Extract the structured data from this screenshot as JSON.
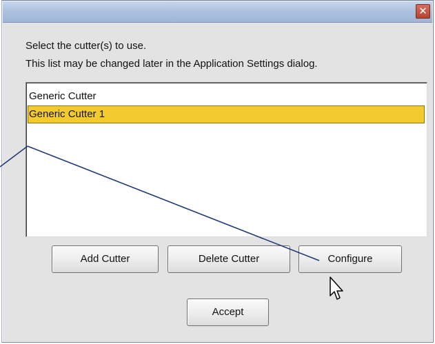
{
  "dialog": {
    "title": "",
    "close_symbol": "✕"
  },
  "instructions": {
    "line1": "Select the cutter(s) to use.",
    "line2": "This list may be changed later in the Application Settings dialog."
  },
  "cutter_list": {
    "items": [
      {
        "label": "Generic Cutter",
        "selected": false
      },
      {
        "label": "Generic Cutter 1",
        "selected": true
      }
    ]
  },
  "buttons": {
    "add": "Add Cutter",
    "delete": "Delete Cutter",
    "configure": "Configure",
    "accept": "Accept"
  },
  "colors": {
    "selection": "#f3cb2e",
    "titlebar": "#adc2df",
    "callout_line": "#1f3a78",
    "close_button": "#b8422f"
  },
  "icons": {
    "close": "close-icon",
    "cursor": "mouse-pointer-icon"
  }
}
